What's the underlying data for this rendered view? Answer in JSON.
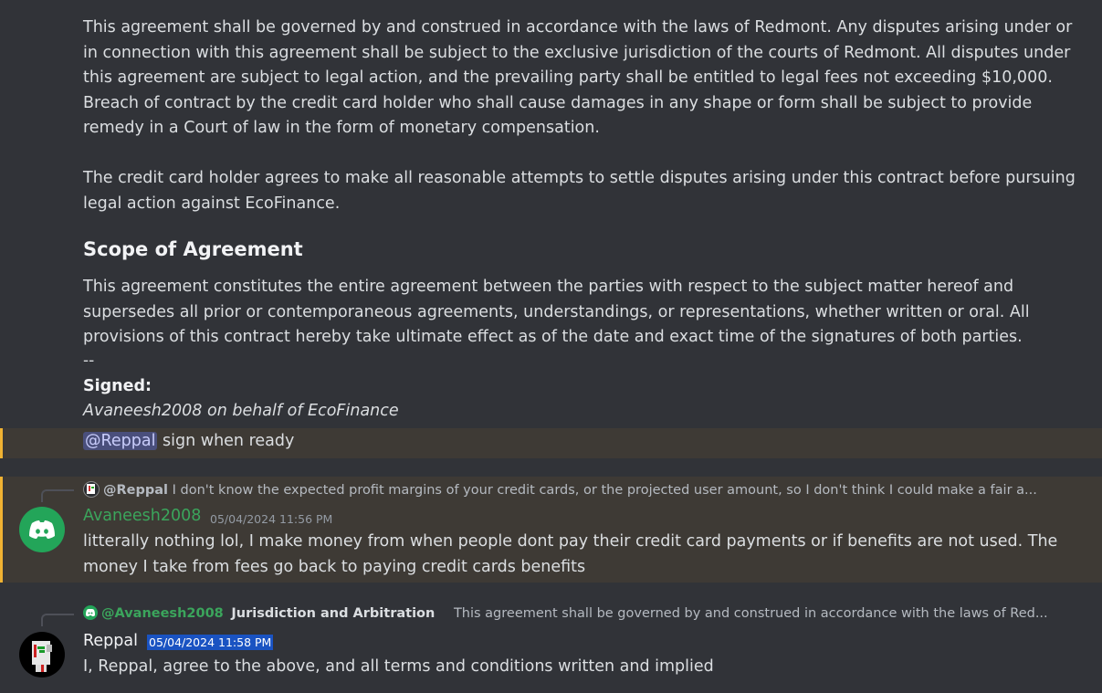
{
  "agreement": {
    "p1": "This agreement shall be governed by and construed in accordance with the laws of Redmont. Any disputes arising under or in connection with this agreement shall be subject to the exclusive jurisdiction of the courts of Redmont. All disputes under this agreement are subject to legal action, and the prevailing party shall be entitled to legal fees not exceeding $10,000. Breach of contract by the credit card holder who shall cause damages in any shape or form shall be subject to provide remedy in a Court of law in the form of monetary compensation.",
    "p2": "The credit card holder agrees to make all reasonable attempts to settle disputes arising under this contract before pursuing legal action against EcoFinance.",
    "scope_heading": "Scope of Agreement",
    "p3": "This agreement constitutes the entire agreement between the parties with respect to the subject matter hereof and supersedes all prior or contemporaneous agreements, understandings, or representations, whether written or oral. All provisions of this contract hereby take ultimate effect as of the date and exact time of the signatures of both parties.",
    "separator": "--",
    "signed_label": "Signed:",
    "signed_by": "Avaneesh2008 on behalf of EcoFinance",
    "mention": "@Reppal",
    "mention_tail": " sign when ready"
  },
  "messages": [
    {
      "reply_to": "@Reppal",
      "reply_preview": "I don't know the expected profit margins of your credit cards, or the projected user amount, so I don't think I could make a fair a...",
      "author": "Avaneesh2008",
      "author_color": "#3ba55c",
      "timestamp": "05/04/2024 11:56 PM",
      "text": "litterally nothing lol, I make money from when people dont pay their credit card payments or if benefits are not used. The money I take from fees go back to paying credit cards benefits",
      "avatar_icon": "discord-icon"
    },
    {
      "reply_to": "@Avaneesh2008",
      "reply_title": "Jurisdiction and Arbitration",
      "reply_preview": "This agreement shall be governed by and construed in accordance with the laws of Red...",
      "author": "Reppal",
      "author_color": "#f2f3f5",
      "timestamp": "05/04/2024 11:58 PM",
      "text": "I, Reppal, agree to the above, and all terms and conditions written and implied",
      "avatar_icon": "pixel-avatar-icon"
    }
  ],
  "colors": {
    "background": "#313338",
    "highlight": "#3e3a35",
    "highlight_bar": "#f0b232",
    "mention_bg": "#4a4f7c",
    "discord_green": "#23a559"
  }
}
